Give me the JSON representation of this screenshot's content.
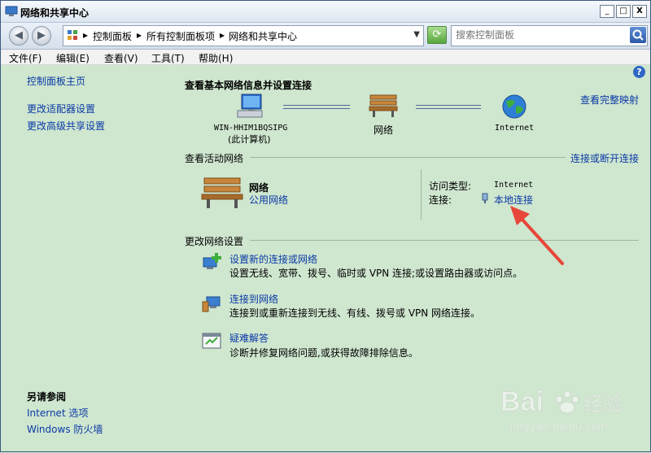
{
  "window": {
    "title": "网络和共享中心",
    "controls": [
      "_",
      "□",
      "X"
    ]
  },
  "address": {
    "crumbs": [
      "控制面板",
      "所有控制面板项",
      "网络和共享中心"
    ],
    "search_placeholder": "搜索控制面板"
  },
  "menu": [
    "文件(F)",
    "编辑(E)",
    "查看(V)",
    "工具(T)",
    "帮助(H)"
  ],
  "sidebar": {
    "home": "控制面板主页",
    "links": [
      "更改适配器设置",
      "更改高级共享设置"
    ],
    "see_also_title": "另请参阅",
    "see_also": [
      "Internet 选项",
      "Windows 防火墙"
    ]
  },
  "main": {
    "heading": "查看基本网络信息并设置连接",
    "full_map": "查看完整映射",
    "map": {
      "computer_name": "WIN-HHIM1BQSIPG",
      "computer_sub": "(此计算机)",
      "network": "网络",
      "internet": "Internet"
    },
    "active": {
      "title": "查看活动网络",
      "connect_link": "连接或断开连接",
      "network_name": "网络",
      "network_type": "公用网络",
      "access_label": "访问类型:",
      "access_value": "Internet",
      "conn_label": "连接:",
      "conn_value": "本地连接"
    },
    "change": {
      "title": "更改网络设置",
      "items": [
        {
          "title": "设置新的连接或网络",
          "desc": "设置无线、宽带、拨号、临时或 VPN 连接;或设置路由器或访问点。"
        },
        {
          "title": "连接到网络",
          "desc": "连接到或重新连接到无线、有线、拨号或 VPN 网络连接。"
        },
        {
          "title": "疑难解答",
          "desc": "诊断并修复网络问题,或获得故障排除信息。"
        }
      ]
    }
  },
  "watermark": {
    "brand": "Bai 经验",
    "url": "jingyan.baidu.com"
  },
  "colors": {
    "link": "#0a3aa6",
    "background": "#cfe6cf",
    "arrow": "#e8463a"
  }
}
